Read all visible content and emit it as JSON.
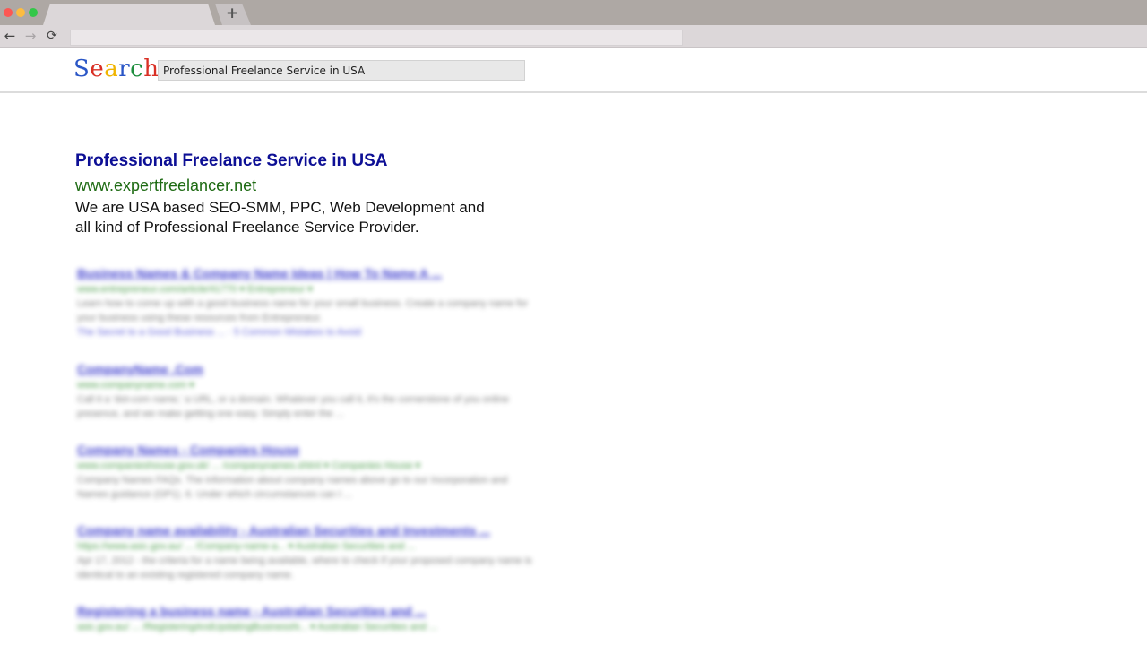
{
  "browser": {
    "new_tab_glyph": "+",
    "back_icon": "←",
    "forward_icon": "→",
    "reload_icon": "⟳"
  },
  "search": {
    "logo_letters": [
      {
        "char": "S",
        "color": "#2a56c6"
      },
      {
        "char": "e",
        "color": "#d93025"
      },
      {
        "char": "a",
        "color": "#f0b400"
      },
      {
        "char": "r",
        "color": "#2a56c6"
      },
      {
        "char": "c",
        "color": "#1e8e3e"
      },
      {
        "char": "h",
        "color": "#d93025"
      }
    ],
    "query": "Professional Freelance Service in USA"
  },
  "main_result": {
    "title": "Professional Freelance Service in USA",
    "url": "www.expertfreelancer.net",
    "description_line1": "We are USA based SEO-SMM, PPC, Web Development and",
    "description_line2": "all kind of Professional Freelance Service Provider."
  },
  "blurred_results": [
    {
      "title": "Business Names & Company Name Ideas | How To Name A ...",
      "url": "www.entrepreneur.com/article/41770 ▾ Entrepreneur ▾",
      "snippet": "Learn how to come up with a good business name for your small business. Create a company name for your business using these resources from Entrepreneur.",
      "links": "The Secret to a Good Business ... · 5 Common Mistakes to Avoid"
    },
    {
      "title": "CompanyName .Com",
      "url": "www.companyname.com ▾",
      "snippet": "Call it a 'dot-com name,' a URL, or a domain. Whatever you call it, it's the cornerstone of you online presence, and we make getting one easy. Simply enter the ...",
      "links": ""
    },
    {
      "title": "Company Names - Companies House",
      "url": "www.companieshouse.gov.uk/ ... /companynames.shtml ▾ Companies House ▾",
      "snippet": "Company Names FAQs. The information about company names above go to our Incorporation and Names guidance (GP1). 6. Under which circumstances can I ...",
      "links": ""
    },
    {
      "title": "Company name availability - Australian Securities and Investments ...",
      "url": "https://www.asic.gov.au/ ... /Company-name-a... ▾ Australian Securities and ...",
      "snippet": "Apr 17, 2012 - the criteria for a name being available, where to check if your proposed company name is identical to an existing registered company name.",
      "links": ""
    },
    {
      "title": "Registering a business name - Australian Securities and ...",
      "url": "asic.gov.au/ ... /RegisteringAndUpdatingBusinessN... ▾ Australian Securities and ...",
      "snippet": "",
      "links": ""
    }
  ]
}
